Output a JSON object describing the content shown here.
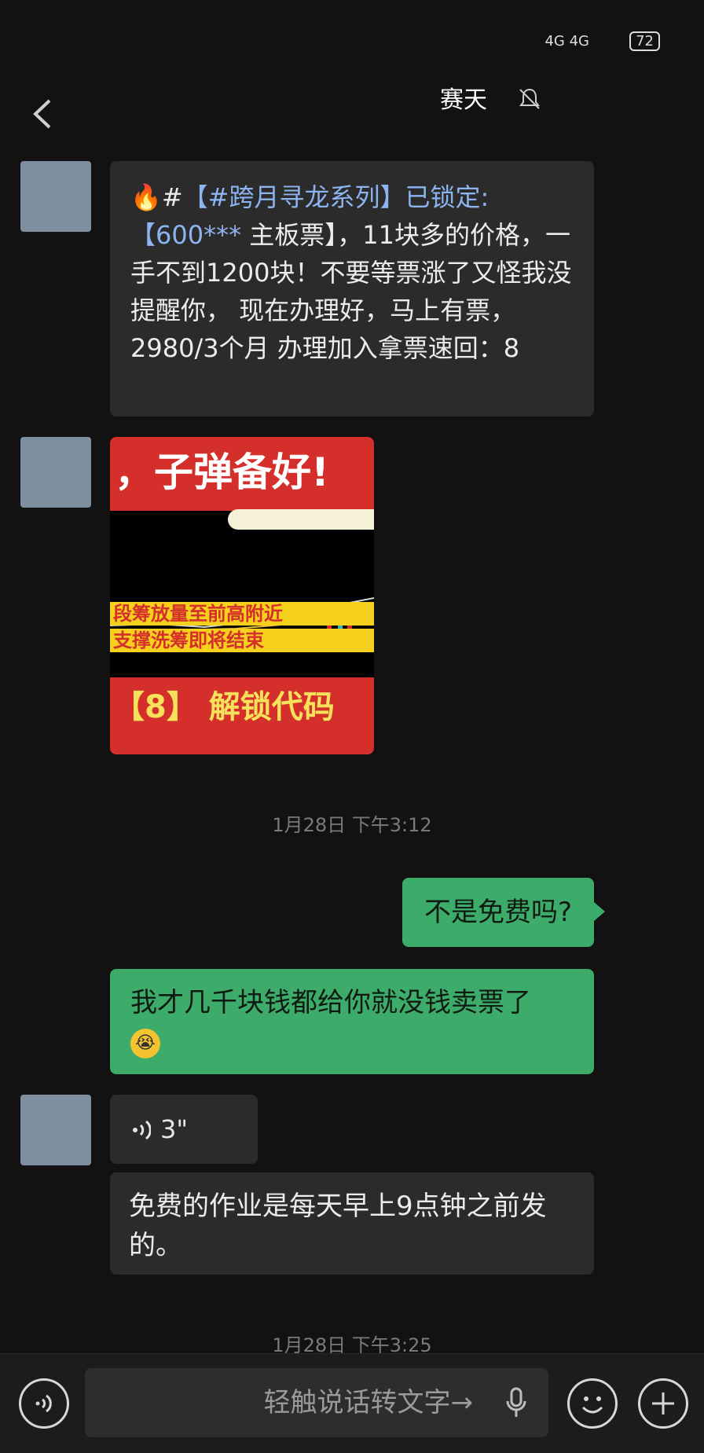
{
  "status": {
    "network": "4G  4G",
    "battery": "72"
  },
  "header": {
    "title": "赛天"
  },
  "messages": {
    "m1_prefix": "🔥#",
    "m1_tag": "【#跨月寻龙系列】已锁定:【600***",
    "m1_text": " 主板票】，11块多的价格，一手不到1200块！不要等票涨了又怪我没提醒你， 现在办理好，马上有票，2980/3个月 办理加入拿票速回：8",
    "img_top": "，子弹备好!",
    "img_line1": "段筹放量至前高附近",
    "img_line2": "支撑洗筹即将结束",
    "img_bottom": "【8】 解锁代码",
    "time1": "1月28日 下午3:12",
    "m_right": "不是免费吗?",
    "m_green2": "我才几千块钱都给你就没钱卖票了",
    "voice_len": "3\"",
    "m_last": "免费的作业是每天早上9点钟之前发的。",
    "time2": "1月28日 下午3:25"
  },
  "input": {
    "placeholder": "轻触说话转文字→"
  },
  "icons": [
    "back-icon",
    "mute-icon",
    "voice-icon",
    "mic-icon",
    "emoji-icon",
    "plus-icon"
  ]
}
